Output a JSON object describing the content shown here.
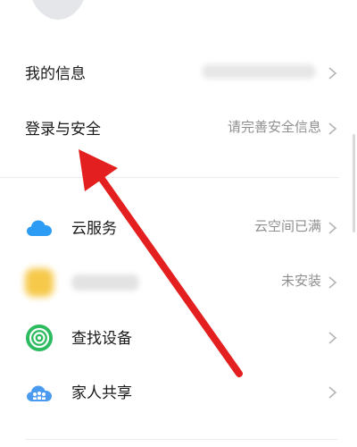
{
  "account": {
    "items": [
      {
        "label": "我的信息",
        "value": ""
      },
      {
        "label": "登录与安全",
        "value": "请完善安全信息"
      }
    ]
  },
  "services": {
    "items": [
      {
        "label": "云服务",
        "value": "云空间已满",
        "icon": "cloud-icon"
      },
      {
        "label": "",
        "value": "未安装",
        "icon": "app-icon"
      },
      {
        "label": "查找设备",
        "value": "",
        "icon": "find-device-icon"
      },
      {
        "label": "家人共享",
        "value": "",
        "icon": "family-sharing-icon"
      }
    ]
  },
  "colors": {
    "cloud": "#2c9cf4",
    "find_device": "#2dbb5f",
    "family": "#4a9bf0",
    "arrow": "#e41f1f"
  }
}
